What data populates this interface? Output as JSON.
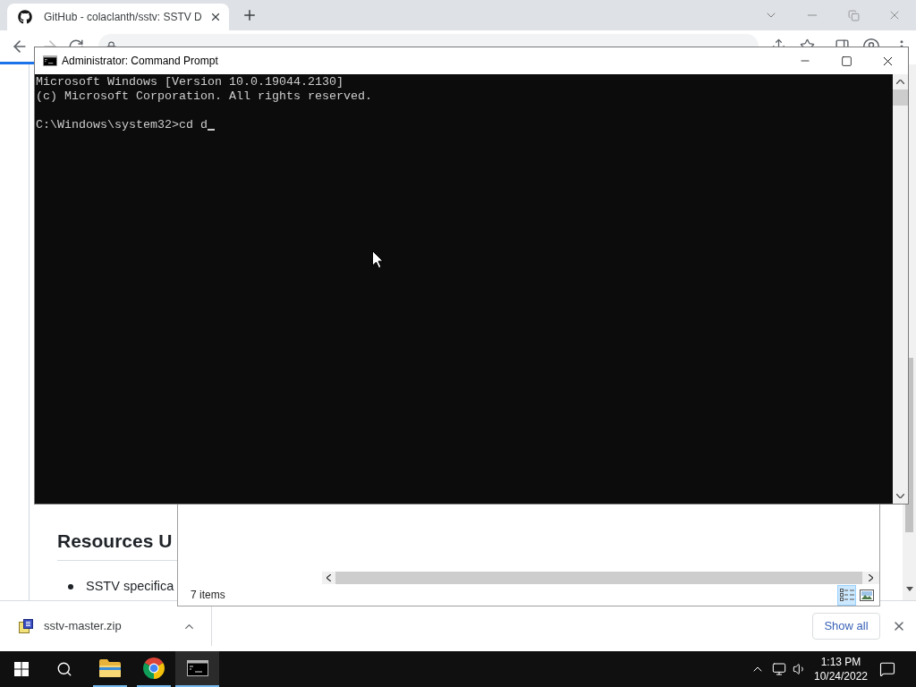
{
  "browser": {
    "tabs": [
      {
        "title": "GitHub - colaclanth/sstv: SSTV D",
        "selected": true
      }
    ],
    "page": {
      "heading": "Resources U",
      "bullets": [
        "SSTV specifica"
      ]
    },
    "downloads": {
      "items": [
        {
          "file_name": "sstv-master.zip"
        }
      ],
      "show_all": "Show all"
    }
  },
  "explorer_window": {
    "status": "7 items",
    "views": [
      {
        "kind": "details",
        "selected": true
      },
      {
        "kind": "large_icons",
        "selected": false
      }
    ]
  },
  "command_prompt": {
    "title": "Administrator: Command Prompt",
    "blocks": [
      [
        "Microsoft Windows [Version 10.0.19044.2130]",
        "(c) Microsoft Corporation. All rights reserved."
      ],
      [
        "C:\\Windows\\system32>cd d"
      ]
    ]
  },
  "taskbar": {
    "apps": [
      {
        "kind": "file_explorer",
        "selected": false
      },
      {
        "kind": "chrome",
        "selected": false
      },
      {
        "kind": "command_prompt",
        "selected": true
      }
    ],
    "time": "1:13 PM",
    "date": "10/24/2022"
  }
}
